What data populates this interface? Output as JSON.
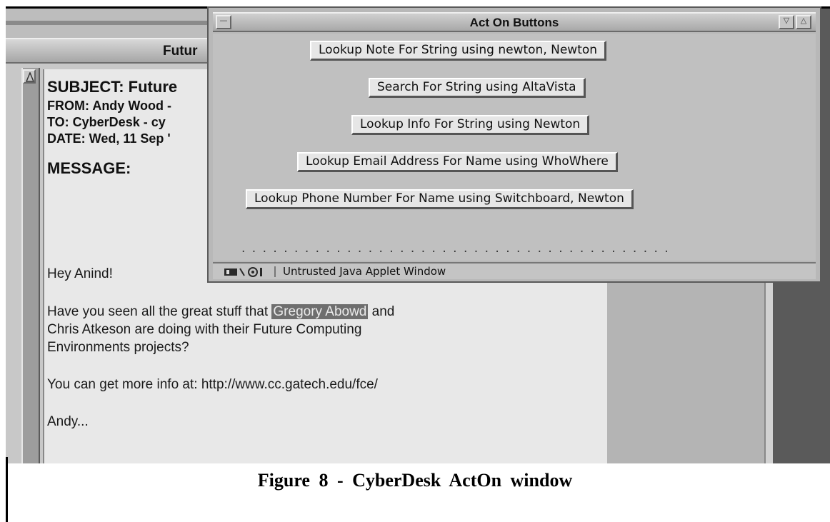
{
  "mail_window": {
    "title": "Futur",
    "subject": "SUBJECT: Future",
    "from": "FROM: Andy Wood -",
    "to": "TO: CyberDesk - cy",
    "date": "DATE: Wed, 11 Sep '",
    "message_label": "MESSAGE:",
    "greeting": "Hey Anind!",
    "line1_before": "Have you seen all the great stuff that ",
    "line1_highlight": "Gregory Abowd",
    "line1_after": " and",
    "line2": "Chris Atkeson are doing with their Future Computing",
    "line3": "Environments projects?",
    "line4": "You can get more info at:  http://www.cc.gatech.edu/fce/",
    "signoff": "Andy..."
  },
  "acton_window": {
    "title": "Act On Buttons",
    "buttons": [
      "Lookup Note For String using newton, Newton",
      "Search For String using AltaVista",
      "Lookup Info For String using Newton",
      "Lookup Email Address For Name using WhoWhere",
      "Lookup Phone Number For Name using Switchboard, Newton"
    ],
    "status_text": "Untrusted Java Applet Window"
  },
  "caption": "Figure 8 - CyberDesk ActOn window"
}
